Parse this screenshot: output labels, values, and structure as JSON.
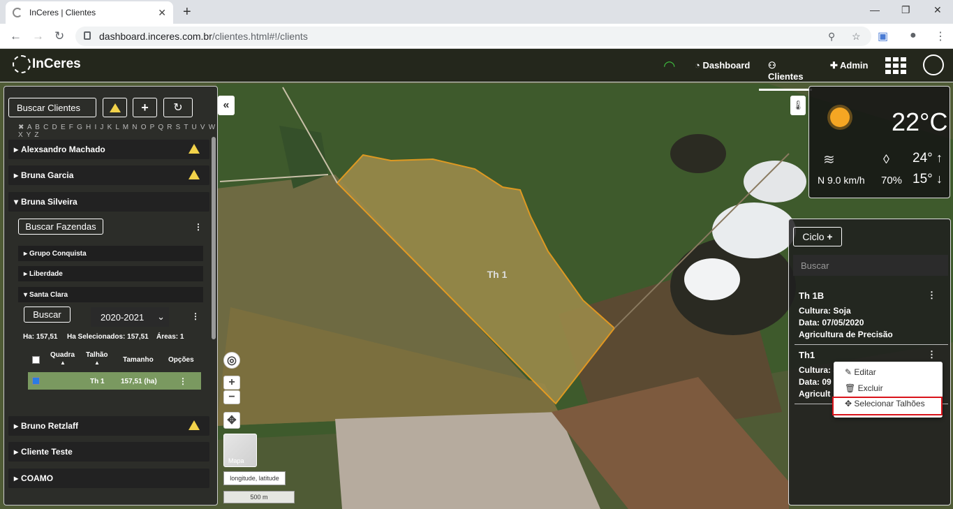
{
  "browser": {
    "tab_title": "InCeres | Clientes",
    "url_host": "dashboard.inceres.com.br",
    "url_path": "/clientes.html#!/clients"
  },
  "header": {
    "logo": "InCeres",
    "nav": [
      {
        "label": "Dashboard"
      },
      {
        "label": "Clientes"
      },
      {
        "label": "Admin"
      }
    ]
  },
  "left": {
    "search_clients": "Buscar Clientes",
    "alphabet": "✖ A B C D E F G H I J K L M N O P Q R S T U V W X Y Z",
    "clients": [
      {
        "name": "Alexsandro Machado",
        "warning": true
      },
      {
        "name": "Bruna Garcia",
        "warning": true
      },
      {
        "name": "Bruna Silveira",
        "warning": false
      },
      {
        "name": "Bruno Retzlaff",
        "warning": true
      },
      {
        "name": "Cliente Teste",
        "warning": false
      },
      {
        "name": "COAMO",
        "warning": false
      }
    ],
    "search_farms": "Buscar Fazendas",
    "farms": [
      "Grupo Conquista",
      "Liberdade",
      "Santa Clara"
    ],
    "search_btn": "Buscar",
    "season": "2020-2021",
    "stats": {
      "ha": "Ha: 157,51",
      "ha_sel": "Ha Selecionados: 157,51",
      "areas": "Áreas: 1"
    },
    "table": {
      "headers": [
        "Quadra",
        "Talhão",
        "Tamanho",
        "Opções"
      ],
      "row": {
        "talhao": "Th 1",
        "tamanho": "157,51 (ha)"
      }
    }
  },
  "map": {
    "field_label": "Th 1",
    "thumb_label": "Mapa",
    "coord_label": "longitude, latitude",
    "scale_label": "500 m"
  },
  "weather": {
    "temp": "22°C",
    "wind": "N 9.0 km/h",
    "humidity": "70%",
    "max": "24°",
    "min": "15°"
  },
  "right": {
    "cycle_btn": "Ciclo",
    "search_placeholder": "Buscar",
    "items": [
      {
        "name": "Th 1B",
        "cultura": "Cultura: Soja",
        "data": "Data: 07/05/2020",
        "tipo": "Agricultura de Precisão"
      },
      {
        "name": "Th1",
        "cultura": "Cultura: S",
        "data": "Data: 09",
        "tipo": "Agricult"
      }
    ],
    "menu": {
      "edit": "Editar",
      "delete": "Excluir",
      "select": "Selecionar Talhões"
    }
  }
}
